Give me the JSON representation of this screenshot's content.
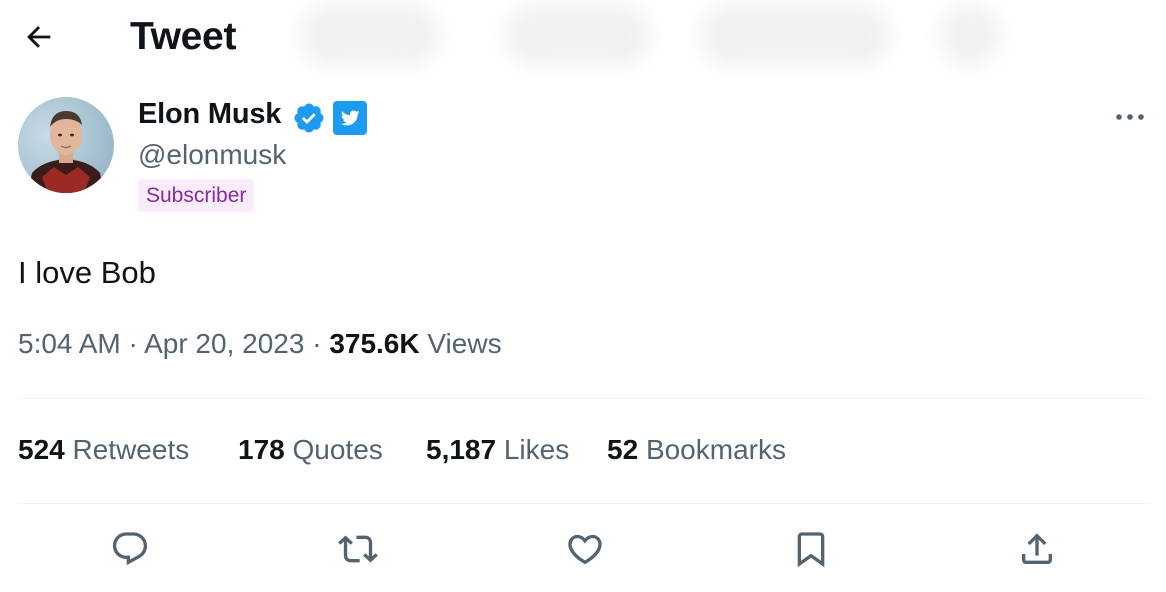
{
  "header": {
    "title": "Tweet",
    "back_icon": "arrow-left-icon"
  },
  "author": {
    "display_name": "Elon Musk",
    "handle": "@elonmusk",
    "subscriber_label": "Subscriber",
    "verified_icon": "verified-badge-icon",
    "affiliate_icon": "twitter-logo-icon"
  },
  "tweet": {
    "text": "I love Bob",
    "time": "5:04 AM",
    "date": "Apr 20, 2023",
    "views_count": "375.6K",
    "views_label": "Views"
  },
  "stats": {
    "retweets": {
      "count": "524",
      "label": "Retweets"
    },
    "quotes": {
      "count": "178",
      "label": "Quotes"
    },
    "likes": {
      "count": "5,187",
      "label": "Likes"
    },
    "bookmarks": {
      "count": "52",
      "label": "Bookmarks"
    }
  },
  "actions": [
    "reply-icon",
    "retweet-icon",
    "like-icon",
    "bookmark-icon",
    "share-icon"
  ],
  "colors": {
    "primary_text": "#0f1419",
    "secondary_text": "#536471",
    "verified_blue": "#1d9bf0",
    "subscriber_purple": "#8a2aa3",
    "subscriber_bg": "#f9ecfb",
    "divider": "#eff3f4"
  }
}
